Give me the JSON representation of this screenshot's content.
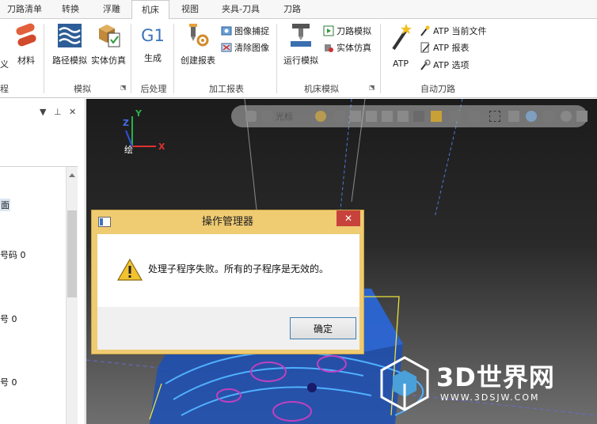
{
  "tabs": [
    {
      "label": "刀路清单"
    },
    {
      "label": "转换"
    },
    {
      "label": "浮雕"
    },
    {
      "label": "机床"
    },
    {
      "label": "视图"
    },
    {
      "label": "夹具-刀具"
    },
    {
      "label": "刀路"
    }
  ],
  "active_tab": "机床",
  "ribbon": {
    "partial_left_label": "义",
    "partial_group_label": "程",
    "material_label": "材料",
    "path_sim_label": "路径模拟",
    "solid_sim_label": "实体仿真",
    "sim_group": "模拟",
    "g1_glyph": "G1",
    "generate_label": "生成",
    "post_group": "后处理",
    "create_report_label": "创建报表",
    "image_capture_label": "图像捕捉",
    "clear_image_label": "清除图像",
    "report_group": "加工报表",
    "run_sim_label": "运行模拟",
    "toolpath_sim_label": "刀路模拟",
    "solid_sim2_label": "实体仿真",
    "machine_sim_group": "机床模拟",
    "atp_label": "ATP",
    "atp_current_label": "ATP 当前文件",
    "atp_report_label": "ATP 报表",
    "atp_options_label": "ATP 选项",
    "auto_path_group": "自动刀路"
  },
  "left_panel": {
    "list_items": [
      "面",
      "号码 0",
      "号 0",
      "号 0"
    ]
  },
  "viewport": {
    "cursor_label": "光标",
    "axis_y": "Y",
    "axis_z": "Z",
    "axis_x": "X",
    "view_label": "绘"
  },
  "dialog": {
    "title": "操作管理器",
    "close_glyph": "✕",
    "message": "处理子程序失败。所有的子程序是无效的。",
    "ok_label": "确定"
  },
  "watermark": {
    "text": "3D世界网",
    "sub": "WWW.3DSJW.COM"
  },
  "colors": {
    "dialog_frame": "#efcb72",
    "close_red": "#c7423b",
    "accent_blue": "#3c7fb1"
  }
}
